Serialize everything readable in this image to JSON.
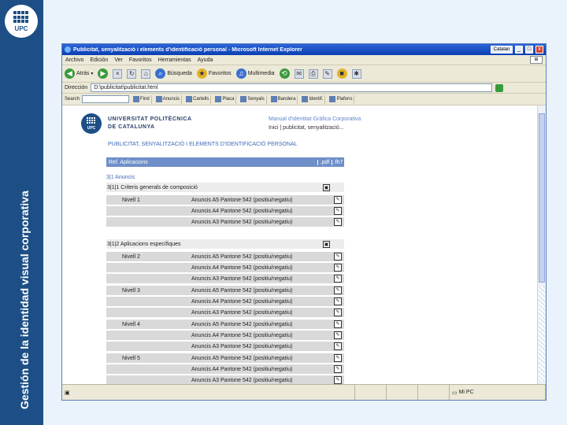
{
  "slide": {
    "title": "Gestión de la identidad visual corporativa",
    "logo_text": "UPC"
  },
  "browser": {
    "window_title": "Publicitat, senyalització i elements d'identificació personal - Microsoft Internet Explorer",
    "title_buttons": [
      "Catalan",
      "_",
      "□",
      "x"
    ],
    "menu": [
      "Archivo",
      "Edición",
      "Ver",
      "Favoritos",
      "Herramientas",
      "Ayuda"
    ],
    "toolbar": {
      "back": "Atrás",
      "search": "Búsqueda",
      "favorites": "Favoritos",
      "multimedia": "Multimedia"
    },
    "address_label": "Dirección",
    "address_value": "D:\\publicitat\\publicitat.html",
    "search_label": "Search",
    "search_tools": [
      "Find",
      "Anuncis",
      "Cartells",
      "Placa",
      "Senyals",
      "Bandera",
      "Identif.",
      "Plafons"
    ],
    "status_right": "Mi PC"
  },
  "page": {
    "logo_text": "UPC",
    "uni_line1": "UNIVERSITAT POLITÈCNICA",
    "uni_line2": "DE CATALUNYA",
    "manual_title": "Manual d'identitat Gràfica Corporativa",
    "breadcrumb": "Inici | publicitat, senyalització...",
    "heading": "PUBLICITAT, SENYALITZACIÓ I ELEMENTS D'IDENTIFICACIÓ PERSONAL",
    "table_header": {
      "ref": "Ref. Aplicacions",
      "pdf": ".pdf",
      "fh": ".fh7"
    },
    "section": "3|1   Anuncis",
    "groups": [
      {
        "label": "3|1|1  Criteris generals de composició"
      },
      {
        "label": "3|1|2  Aplicacions específiques"
      }
    ],
    "rows": [
      {
        "level": "Nivell 1",
        "name": "Anuncis A5 Pantone 542 (positiu/negatiu)"
      },
      {
        "level": "",
        "name": "Anuncis A4 Pantone 542 (positiu/negatiu)"
      },
      {
        "level": "",
        "name": "Anuncis A3 Pantone 542 (positiu/negatiu)"
      },
      {
        "level": "Nivell 2",
        "name": "Anuncis A5 Pantone 542 (positiu/negatiu)"
      },
      {
        "level": "",
        "name": "Anuncis A4 Pantone 542 (positiu/negatiu)"
      },
      {
        "level": "",
        "name": "Anuncis A3 Pantone 542 (positiu/negatiu)"
      },
      {
        "level": "Nivell 3",
        "name": "Anuncis A5 Pantone 542 (positiu/negatiu)"
      },
      {
        "level": "",
        "name": "Anuncis A4 Pantone 542 (positiu/negatiu)"
      },
      {
        "level": "",
        "name": "Anuncis A3 Pantone 542 (positiu/negatiu)"
      },
      {
        "level": "Nivell 4",
        "name": "Anuncis A5 Pantone 542 (positiu/negatiu)"
      },
      {
        "level": "",
        "name": "Anuncis A4 Pantone 542 (positiu/negatiu)"
      },
      {
        "level": "",
        "name": "Anuncis A3 Pantone 542 (positiu/negatiu)"
      },
      {
        "level": "Nivell 5",
        "name": "Anuncis A5 Pantone 542 (positiu/negatiu)"
      },
      {
        "level": "",
        "name": "Anuncis A4 Pantone 542 (positiu/negatiu)"
      },
      {
        "level": "",
        "name": "Anuncis A3 Pantone 542 (positiu/negatiu)"
      }
    ]
  },
  "colors": {
    "band": "#1d4f86",
    "table_header": "#6e8fc9",
    "link": "#3c6ab8"
  }
}
